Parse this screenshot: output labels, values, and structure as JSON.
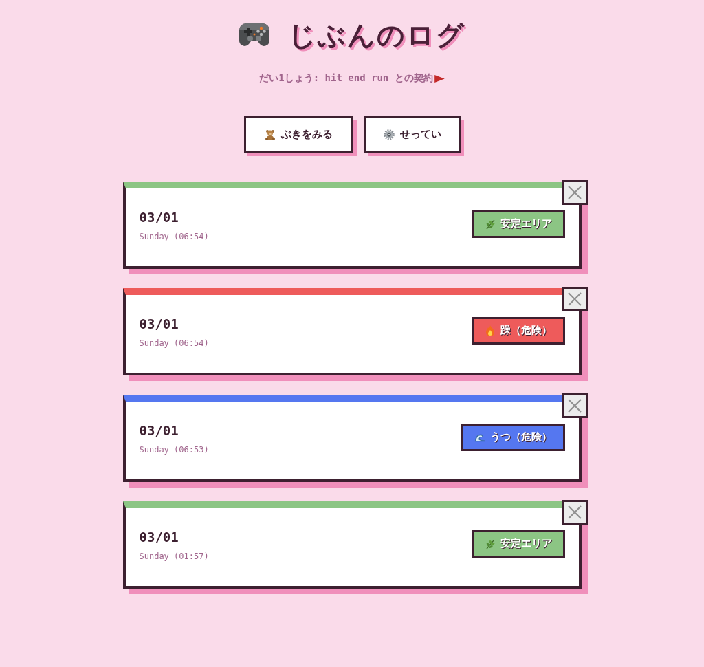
{
  "header": {
    "title": "じぶんのログ",
    "subtitle": "だい1しょう: hit end run との契約"
  },
  "buttons": [
    {
      "label": "ぶきをみる",
      "kind": "weapons"
    },
    {
      "label": "せってい",
      "kind": "settings"
    }
  ],
  "entries": [
    {
      "date": "03/01",
      "time": "Sunday (06:54)",
      "status": "安定エリア",
      "kind": "calm",
      "color": "#8cc584"
    },
    {
      "date": "03/01",
      "time": "Sunday (06:54)",
      "status": "躁（危険）",
      "kind": "mania",
      "color": "#ee5b5b"
    },
    {
      "date": "03/01",
      "time": "Sunday (06:53)",
      "status": "うつ（危険）",
      "kind": "depression",
      "color": "#5577f0"
    },
    {
      "date": "03/01",
      "time": "Sunday (01:57)",
      "status": "安定エリア",
      "kind": "calm",
      "color": "#8cc584"
    }
  ]
}
